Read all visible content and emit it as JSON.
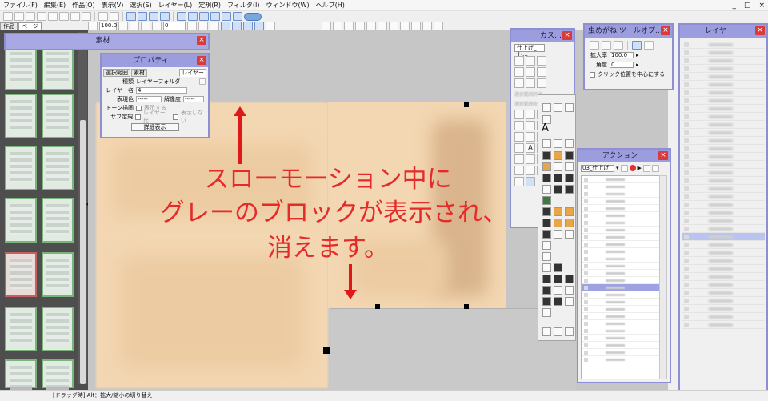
{
  "menu": [
    "ファイル(F)",
    "編集(E)",
    "作品(O)",
    "表示(V)",
    "選択(S)",
    "レイヤー(L)",
    "定規(R)",
    "フィルタ(I)",
    "ウィンドウ(W)",
    "ヘルプ(H)"
  ],
  "window_controls": [
    "_",
    "□",
    "×"
  ],
  "toolbar2": {
    "zoom_value": "100.0",
    "rotate_value": "0"
  },
  "page_tabs": [
    "作品",
    "ページ"
  ],
  "palettes": {
    "sozai": {
      "title": "素材"
    },
    "property": {
      "title": "プロパティ",
      "tabs": [
        "選択範囲",
        "素材",
        "レイヤー"
      ],
      "rows": [
        {
          "label": "種類",
          "value": "レイヤーフォルダ"
        },
        {
          "label": "レイヤー名",
          "value": "4"
        },
        {
          "label": "表現色",
          "value": "-----",
          "label2": "解像度",
          "value2": "-----"
        },
        {
          "label": "トーン描画",
          "value": "表示する"
        },
        {
          "label": "サブ定規",
          "value": "レイヤー比",
          "value2": "表示しない"
        }
      ],
      "button": "詳細表示"
    },
    "custom": {
      "title": "カス…",
      "dropdown": "仕上げ_ト…",
      "blurred_hint_1": "選択範囲外を…",
      "blurred_hint_2": "選択範囲を…"
    },
    "loupe": {
      "title": "虫めがね ツールオプ…",
      "zoom_label": "拡大率",
      "zoom_value": "100.0",
      "angle_label": "角度",
      "angle_value": "0",
      "checkbox_label": "クリック位置を中心にする"
    },
    "action": {
      "title": "アクション",
      "set_name": "03_仕上げ"
    },
    "layers": {
      "title": "レイヤー"
    }
  },
  "annotation": {
    "line1": "スローモーション中に",
    "line2": "グレーのブロックが表示され、",
    "line3": "消えます。"
  },
  "status_bar": "[ドラッグ時] Alt：拡大/縮小の切り替え",
  "colors": {
    "palette_title": "#9c9dde",
    "close_button": "#d93a3a",
    "annotation_red": "#e52a2a",
    "paper": "#f3d7b2",
    "canvas_gray": "#c6c6c6",
    "gray_block": "#c9c9c9"
  }
}
